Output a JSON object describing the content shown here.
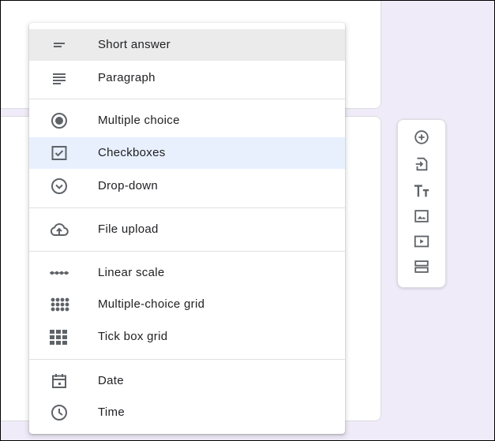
{
  "menu": {
    "items": [
      {
        "label": "Short answer",
        "icon": "short-answer-icon"
      },
      {
        "label": "Paragraph",
        "icon": "paragraph-icon"
      },
      {
        "label": "Multiple choice",
        "icon": "radio-button-icon"
      },
      {
        "label": "Checkboxes",
        "icon": "checkbox-icon"
      },
      {
        "label": "Drop-down",
        "icon": "dropdown-circle-icon"
      },
      {
        "label": "File upload",
        "icon": "cloud-upload-icon"
      },
      {
        "label": "Linear scale",
        "icon": "linear-scale-icon"
      },
      {
        "label": "Multiple-choice grid",
        "icon": "dot-grid-icon"
      },
      {
        "label": "Tick box grid",
        "icon": "square-grid-icon"
      },
      {
        "label": "Date",
        "icon": "calendar-icon"
      },
      {
        "label": "Time",
        "icon": "clock-icon"
      }
    ]
  },
  "toolbar": {
    "buttons": [
      "add-question-icon",
      "import-questions-icon",
      "add-title-icon",
      "add-image-icon",
      "add-video-icon",
      "add-section-icon"
    ]
  },
  "colors": {
    "icon": "#5f6368",
    "hover": "#ebebeb",
    "selected": "#e8f0fe",
    "background": "#f0ebf8"
  }
}
